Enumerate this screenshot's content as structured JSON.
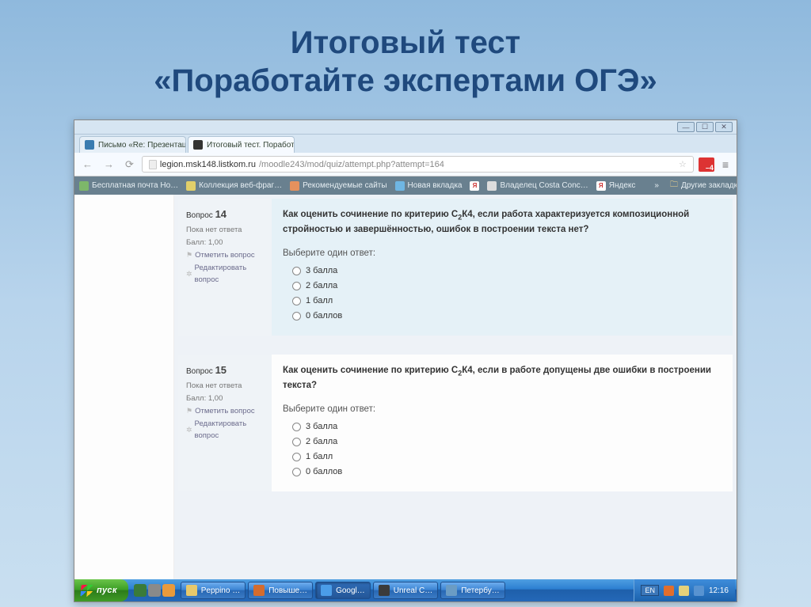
{
  "slide": {
    "title_line1": "Итоговый тест",
    "title_line2": "«Поработайте экспертами ОГЭ»"
  },
  "browser": {
    "tabs": [
      {
        "label": "Письмо «Re: Презентации т",
        "icon_name": "mail-icon"
      },
      {
        "label": "Итоговый тест. Поработай",
        "icon_name": "moodle-icon"
      }
    ],
    "url_host": "legion.msk148.listkom.ru",
    "url_path": "/moodle243/mod/quiz/attempt.php?attempt=164"
  },
  "bookmarks": {
    "items": [
      "Бесплатная почта Но…",
      "Коллекция веб-фраг…",
      "Рекомендуемые сайты",
      "Новая вкладка",
      "Я",
      "Владелец Costa Conc…",
      "Яндекс"
    ],
    "other": "Другие закладки"
  },
  "questions": [
    {
      "number": "14",
      "label_prefix": "Вопрос ",
      "status": "Пока нет ответа",
      "score": "Балл: 1,00",
      "flag": "Отметить вопрос",
      "edit": "Редактировать вопрос",
      "text_before": "Как оценить сочинение по критерию С",
      "text_sub": "2",
      "text_mid": "К4, если работа  характеризуется композиционной  стройностью и завершённостью, ошибок в построении текста нет?",
      "choose": "Выберите один ответ:",
      "options": [
        "3 балла",
        "2 балла",
        "1 балл",
        "0 баллов"
      ],
      "bg": "blue"
    },
    {
      "number": "15",
      "label_prefix": "Вопрос ",
      "status": "Пока нет ответа",
      "score": "Балл: 1,00",
      "flag": "Отметить вопрос",
      "edit": "Редактировать вопрос",
      "text_before": "Как оценить сочинение по критерию С",
      "text_sub": "2",
      "text_mid": "К4, если в работе допущены две ошибки в построении текста?",
      "choose": "Выберите один ответ:",
      "options": [
        "3 балла",
        "2 балла",
        "1 балл",
        "0 баллов"
      ],
      "bg": "white"
    }
  ],
  "taskbar": {
    "start": "пуск",
    "tasks": [
      {
        "label": "Peppino …",
        "color": "#e7c86b"
      },
      {
        "label": "Повыше…",
        "color": "#d46c2e"
      },
      {
        "label": "Googl…",
        "color": "#4b9de8"
      },
      {
        "label": "Unreal C…",
        "color": "#3b3b3b"
      },
      {
        "label": "Петербу…",
        "color": "#6b9cc4"
      }
    ],
    "lang": "EN",
    "time": "12:16"
  }
}
